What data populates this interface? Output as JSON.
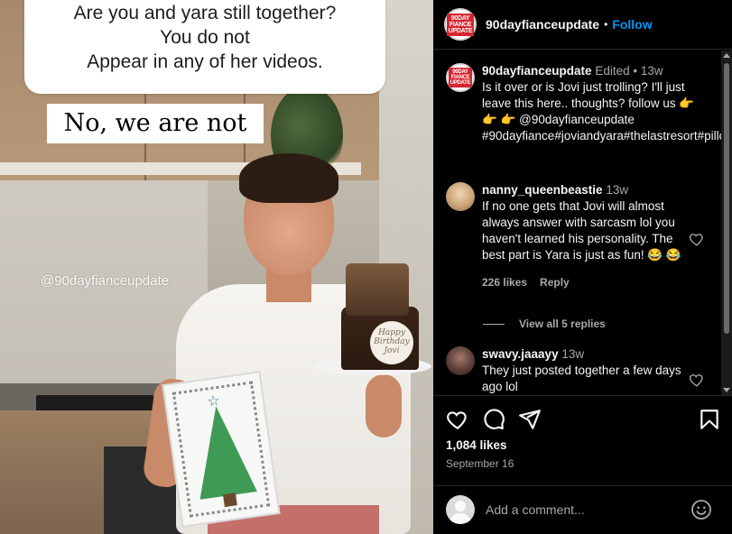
{
  "media": {
    "question_bubble": [
      "Are you and yara still together?",
      "You do not",
      "Appear in any of her videos."
    ],
    "answer_caption": "No, we are not",
    "watermark": "@90dayfianceupdate",
    "card_plaque": [
      "Happy",
      "Birthday",
      "Jovi"
    ],
    "logo_text": [
      "90DAY",
      "FIANCE",
      "UPDATE"
    ]
  },
  "post": {
    "header": {
      "username": "90dayfianceupdate",
      "separator": "•",
      "follow_label": "Follow"
    },
    "caption": {
      "username": "90dayfianceupdate",
      "meta": "Edited • 13w",
      "text": "Is it over or is Jovi just trolling? I'll just leave this here.. thoughts? follow us 👉 👉 👉 @90dayfianceupdate #90dayfiance#joviandyara#thelastresort#pillowtalk"
    },
    "comments": [
      {
        "username": "nanny_queenbeastie",
        "age": "13w",
        "text": "If no one gets that Jovi will almost always answer with sarcasm lol you haven't learned his personality. The best part is Yara is just as fun! 😂 😂",
        "likes": "226 likes",
        "reply_label": "Reply",
        "view_replies": "View all 5 replies"
      },
      {
        "username": "swavy.jaaayy",
        "age": "13w",
        "text": "They just posted together a few days ago lol"
      }
    ],
    "likes_count": "1,084 likes",
    "date": "September 16",
    "add_comment_placeholder": "Add a comment...",
    "icons": [
      "heart-icon",
      "comment-icon",
      "share-icon",
      "bookmark-icon",
      "emoji-icon"
    ],
    "colors": {
      "background": "#000000",
      "text": "#f5f5f5",
      "muted": "#a8a8a8",
      "link": "#0095f6",
      "border": "#262626"
    }
  }
}
